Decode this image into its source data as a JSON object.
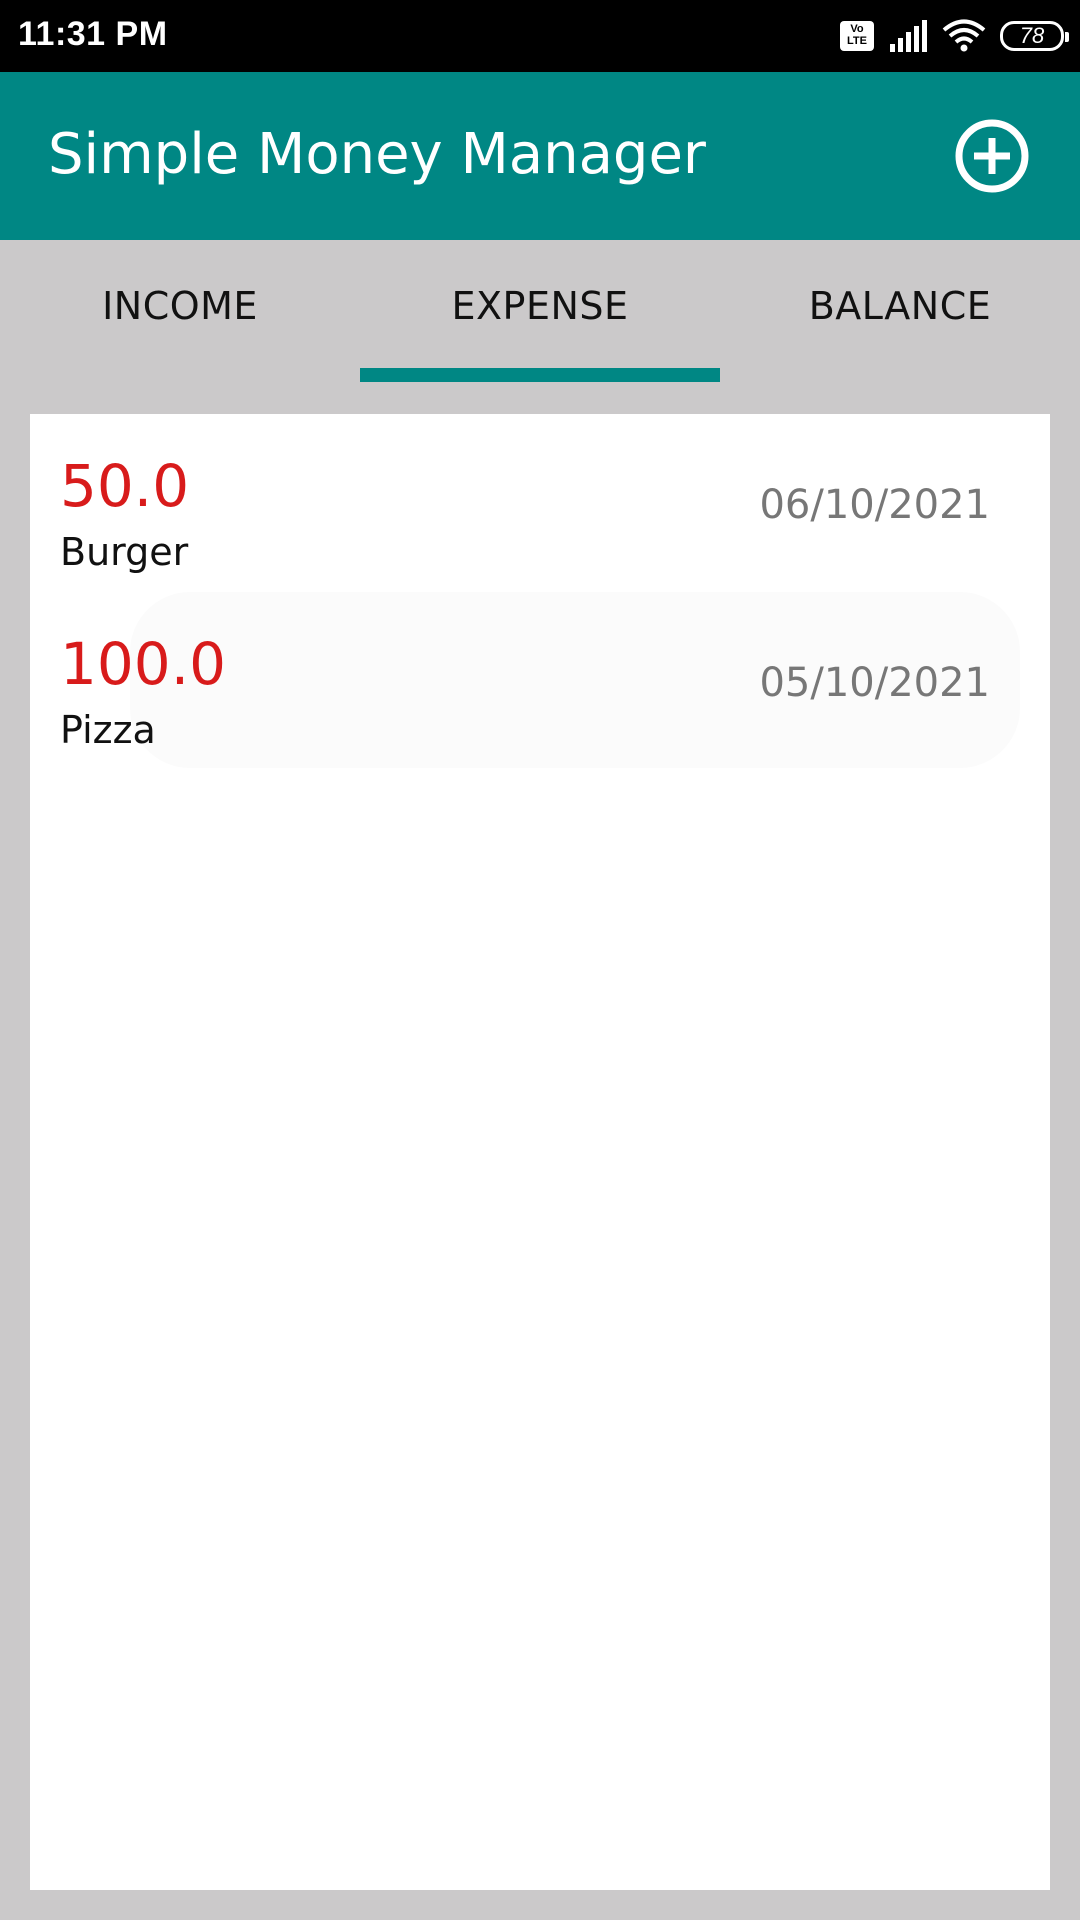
{
  "status_bar": {
    "time": "11:31 PM",
    "volte_label_top": "Vo",
    "volte_label_bottom": "LTE",
    "battery_level": "78"
  },
  "app_bar": {
    "title": "Simple Money Manager",
    "add_icon": "add-circle-icon",
    "background_color": "#008784"
  },
  "tabs": [
    {
      "label": "INCOME",
      "selected": false
    },
    {
      "label": "EXPENSE",
      "selected": true
    },
    {
      "label": "BALANCE",
      "selected": false
    }
  ],
  "expenses": [
    {
      "amount": "50.0",
      "name": "Burger",
      "date": "06/10/2021"
    },
    {
      "amount": "100.0",
      "name": "Pizza",
      "date": "05/10/2021"
    }
  ],
  "colors": {
    "accent": "#008784",
    "amount": "#d81b1b",
    "date": "#777777",
    "background": "#cbc9ca"
  }
}
